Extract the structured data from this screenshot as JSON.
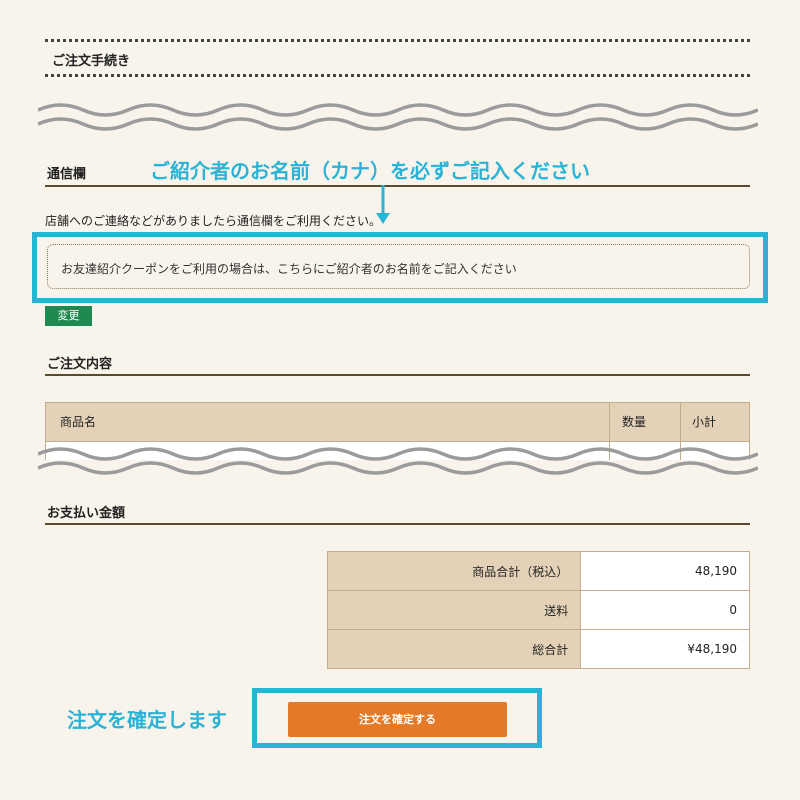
{
  "order": {
    "section_title": "ご注文手続き"
  },
  "memo_section": {
    "title": "通信欄",
    "description": "店舗へのご連絡などがありましたら通信欄をご利用ください。",
    "memo_text": "お友達紹介クーポンをご利用の場合は、こちらにご紹介者のお名前をご記入ください",
    "change_button": "変更"
  },
  "annotations": {
    "referrer_note": "ご紹介者のお名前（カナ）を必ずご記入ください",
    "confirm_note": "注文を確定します"
  },
  "items_section": {
    "title": "ご注文内容",
    "columns": [
      "商品名",
      "数量",
      "小計"
    ]
  },
  "payment_section": {
    "title": "お支払い金額",
    "rows": [
      {
        "label": "商品合計（税込）",
        "value": "48,190"
      },
      {
        "label": "送料",
        "value": "0"
      },
      {
        "label": "総合計",
        "value": "¥48,190"
      }
    ]
  },
  "confirm_button": "注文を確定する",
  "colors": {
    "annotation": "#2bb3d6",
    "change_button": "#1e8a4f",
    "confirm_button": "#e47a27",
    "table_header": "#e4d2b8"
  },
  "icons": [
    "wave-separator-icon",
    "arrow-down-icon"
  ]
}
